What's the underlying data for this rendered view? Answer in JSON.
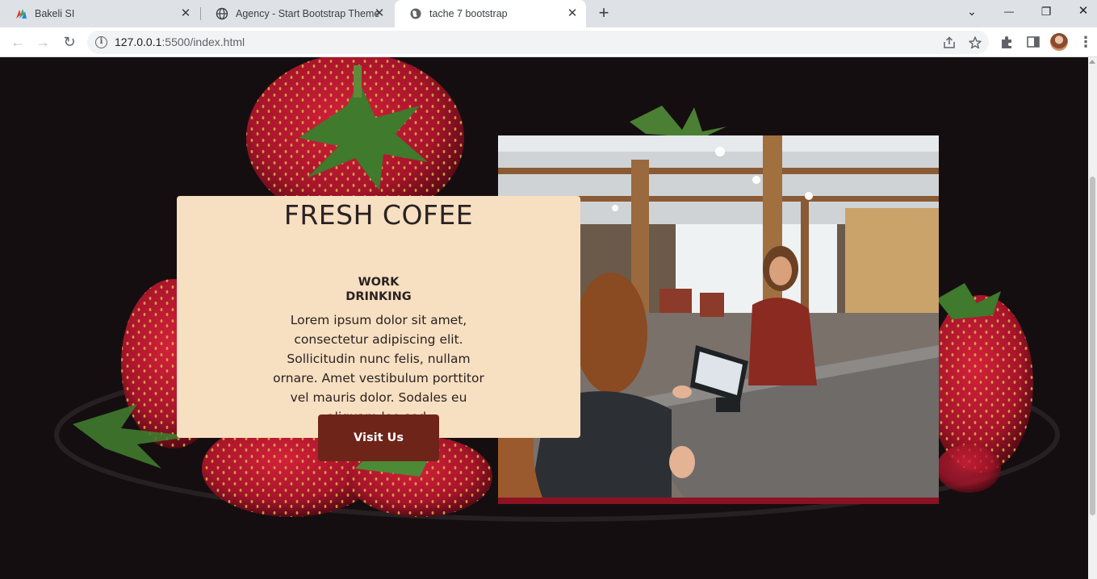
{
  "browser": {
    "tabs": [
      {
        "title": "Bakeli SI",
        "favicon": "bakeli-logo-icon",
        "active": false
      },
      {
        "title": "Agency - Start Bootstrap Theme",
        "favicon": "globe-icon",
        "active": false
      },
      {
        "title": "tache 7 bootstrap",
        "favicon": "globe-icon",
        "active": true
      }
    ],
    "close_glyph": "✕",
    "new_tab_glyph": "+",
    "window_controls": {
      "dropdown": "⌄",
      "minimize": "—",
      "restore": "❐",
      "close": "✕"
    },
    "nav": {
      "back": "←",
      "forward": "→",
      "reload": "↻"
    },
    "address": {
      "host": "127.0.0.1",
      "path": ":5500/index.html",
      "info_glyph": "i"
    },
    "menu_glyph": "⋮"
  },
  "page": {
    "card": {
      "title": "FRESH COFEE",
      "subtitle_line1": "WORK",
      "subtitle_line2": "DRINKING",
      "body": "Lorem ipsum dolor sit amet, consectetur adipiscing elit. Sollicitudin nunc felis, nullam ornare. Amet vestibulum porttitor vel mauris dolor. Sodales eu aliquam leo sed.",
      "button_label": "Visit Us"
    },
    "colors": {
      "background": "#150e10",
      "card": "#f7dfc1",
      "button": "#6e2418",
      "strawberry": "#b3152a"
    }
  }
}
